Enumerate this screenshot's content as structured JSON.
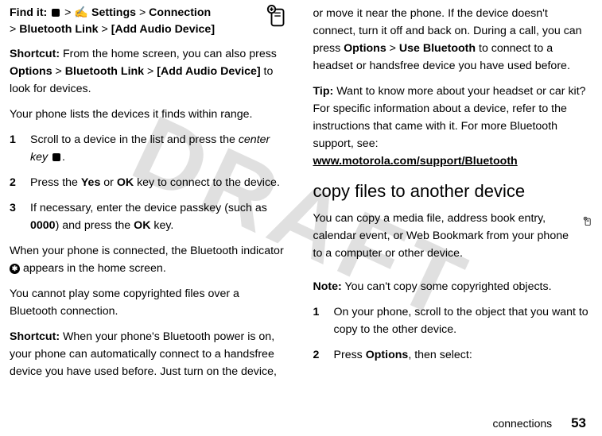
{
  "watermark": "DRAFT",
  "left": {
    "findit_label": "Find it:",
    "findit_path_1": "Settings",
    "findit_path_2": "Connection",
    "findit_path_3": "Bluetooth Link",
    "findit_path_4": "[Add Audio Device]",
    "shortcut_label": "Shortcut:",
    "shortcut_text_1": " From the home screen, you can also press ",
    "shortcut_b1": "Options",
    "shortcut_b2": "Bluetooth Link",
    "shortcut_b3": "[Add Audio Device]",
    "shortcut_text_2": " to look for devices.",
    "list_intro": "Your phone lists the devices it finds within range.",
    "step1_a": "Scroll to a device in the list and press the ",
    "step1_b": "center key",
    "step2_a": "Press the ",
    "step2_yes": "Yes",
    "step2_or": " or ",
    "step2_ok": "OK",
    "step2_b": " key to connect to the device.",
    "step3_a": "If necessary, enter the device passkey (such as ",
    "step3_code": "0000",
    "step3_b": ") and press the ",
    "step3_ok": "OK",
    "step3_c": " key.",
    "connected_a": "When your phone is connected, the Bluetooth indicator ",
    "connected_b": " appears in the home screen.",
    "copyright": "You cannot play some copyrighted files over a Bluetooth connection.",
    "shortcut2_label": "Shortcut:",
    "shortcut2_text": " When your phone's Bluetooth power is on, your phone can automatically connect to a handsfree device you have used before. Just turn on the device,"
  },
  "right": {
    "cont_a": "or move it near the phone. If the device doesn't connect, turn it off and back on. During a call, you can press ",
    "cont_b1": "Options",
    "cont_b2": "Use Bluetooth",
    "cont_c": " to connect to a headset or handsfree device you have used before.",
    "tip_label": "Tip:",
    "tip_text": " Want to know more about your headset or car kit? For specific information about a device, refer to the instructions that came with it. For more Bluetooth support, see: ",
    "tip_link": "www.motorola.com/support/Bluetooth",
    "section_title": "copy files to another device",
    "copy_intro": "You can copy a media file, address book entry, calendar event, or Web Bookmark from your phone to a computer or other device.",
    "note_label": "Note:",
    "note_text": " You can't copy some copyrighted objects.",
    "r_step1": "On your phone, scroll to the object that you want to copy to the other device.",
    "r_step2_a": "Press ",
    "r_step2_b": "Options",
    "r_step2_c": ", then select:"
  },
  "footer": {
    "label": "connections",
    "page": "53"
  }
}
